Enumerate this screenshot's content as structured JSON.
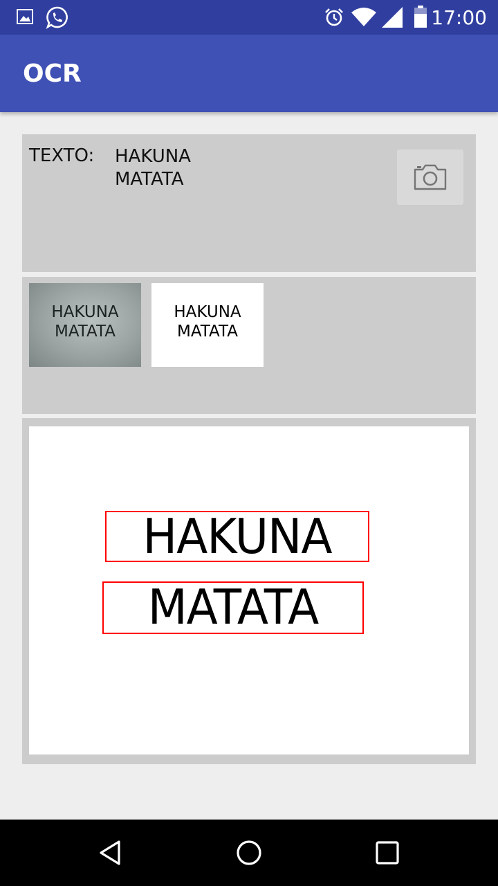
{
  "status_bar": {
    "time": "17:00",
    "left_icons": [
      "gallery-notification-icon",
      "whatsapp-icon"
    ],
    "right_icons": [
      "alarm-icon",
      "wifi-icon",
      "signal-icon",
      "battery-icon"
    ]
  },
  "app_bar": {
    "title": "OCR"
  },
  "result": {
    "label": "TEXTO:",
    "lines": [
      "HAKUNA",
      "MATATA"
    ]
  },
  "camera_button": {
    "icon": "camera-icon"
  },
  "thumbnails": {
    "original": {
      "lines": [
        "HAKUNA",
        "MATATA"
      ]
    },
    "processed": {
      "lines": [
        "HAKUNA",
        "MATATA"
      ]
    }
  },
  "preview": {
    "detected_words": [
      "HAKUNA",
      "MATATA"
    ],
    "box_color": "#ff0000"
  },
  "nav_bar": {
    "buttons": [
      "back-icon",
      "home-icon",
      "recents-icon"
    ]
  },
  "colors": {
    "status_bar": "#303f9f",
    "app_bar": "#3f51b5",
    "background": "#eeeeee",
    "panel": "#cccccc"
  }
}
